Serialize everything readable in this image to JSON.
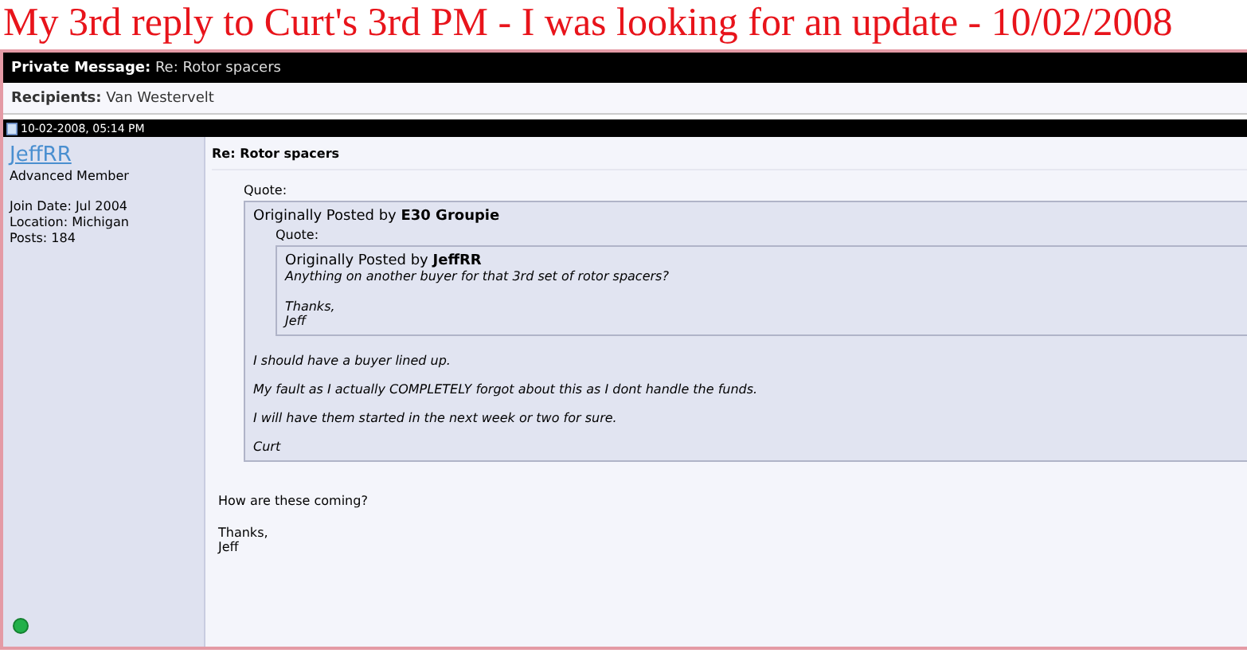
{
  "page_title": "My 3rd reply to Curt's 3rd PM - I was looking for an update - 10/02/2008",
  "header": {
    "label": "Private Message:",
    "value": "Re: Rotor spacers"
  },
  "recipients": {
    "label": "Recipients:",
    "value": "Van Westervelt"
  },
  "post": {
    "date": "10-02-2008, 05:14 PM",
    "author": {
      "name": "JeffRR",
      "rank": "Advanced Member",
      "details": [
        "Join Date: Jul 2004",
        "Location: Michigan",
        "Posts: 184"
      ],
      "online": true
    },
    "title": "Re: Rotor spacers",
    "quote": {
      "label": "Quote:",
      "intro": "Originally Posted by",
      "author": "E30 Groupie",
      "inner": {
        "label": "Quote:",
        "intro": "Originally Posted by",
        "author": "JeffRR",
        "paragraphs": [
          "Anything on another buyer for that 3rd set of rotor spacers?",
          "Thanks,\nJeff"
        ]
      },
      "paragraphs": [
        "I should have a buyer lined up.",
        "My fault as I actually COMPLETELY forgot about this as I dont handle the funds.",
        "I will have them started in the next week or two for sure.",
        "Curt"
      ]
    },
    "paragraphs": [
      "How are these coming?",
      "Thanks,\nJeff"
    ]
  }
}
